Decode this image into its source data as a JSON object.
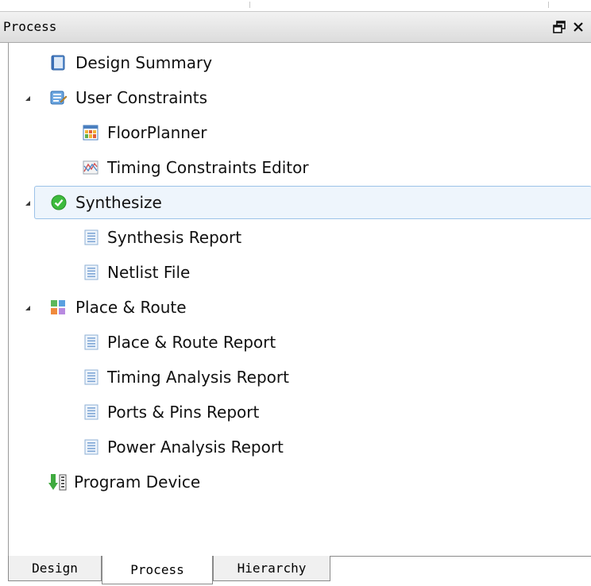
{
  "panel": {
    "title": "Process",
    "float_icon": "float-window-icon",
    "close_icon": "close-icon"
  },
  "tree": {
    "items": [
      {
        "label": "Design Summary",
        "icon": "design-summary-icon",
        "expandable": false
      },
      {
        "label": "User Constraints",
        "icon": "user-constraints-icon",
        "expandable": true,
        "expanded": true
      },
      {
        "label": "FloorPlanner",
        "icon": "floorplanner-icon",
        "expandable": false
      },
      {
        "label": "Timing Constraints Editor",
        "icon": "timing-constraints-icon",
        "expandable": false
      },
      {
        "label": "Synthesize",
        "icon": "check-circle-icon",
        "expandable": true,
        "expanded": true,
        "selected": true,
        "status_color": "#3dbb3d"
      },
      {
        "label": "Synthesis Report",
        "icon": "report-document-icon",
        "expandable": false
      },
      {
        "label": "Netlist File",
        "icon": "report-document-icon",
        "expandable": false
      },
      {
        "label": "Place & Route",
        "icon": "place-route-icon",
        "expandable": true,
        "expanded": true
      },
      {
        "label": "Place & Route Report",
        "icon": "report-document-icon",
        "expandable": false
      },
      {
        "label": "Timing Analysis Report",
        "icon": "report-document-icon",
        "expandable": false
      },
      {
        "label": "Ports & Pins Report",
        "icon": "report-document-icon",
        "expandable": false
      },
      {
        "label": "Power Analysis Report",
        "icon": "report-document-icon",
        "expandable": false
      },
      {
        "label": "Program Device",
        "icon": "program-device-icon",
        "expandable": false
      }
    ]
  },
  "tabs": [
    {
      "label": "Design",
      "active": false
    },
    {
      "label": "Process",
      "active": true
    },
    {
      "label": "Hierarchy",
      "active": false
    }
  ],
  "colors": {
    "selection_bg": "#eef5fc",
    "selection_border": "#9cc2e8",
    "header_bg": "#e6e6e6"
  }
}
